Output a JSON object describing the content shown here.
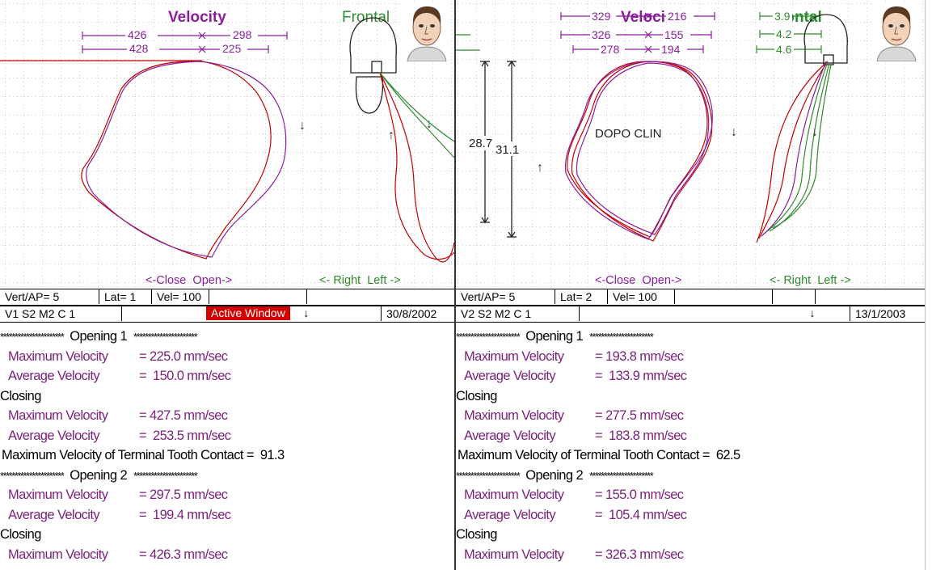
{
  "left_window": {
    "title_velocity": "Velocity",
    "title_frontal": "Frontal",
    "scale_top": [
      "426",
      "298"
    ],
    "scale_bottom": [
      "428",
      "225"
    ],
    "axis_sagittal": "<-Close  Open->",
    "axis_frontal": "<- Right  Left ->",
    "status": {
      "vert_ap": "Vert/AP= 5",
      "lat": "Lat= 1",
      "vel": "Vel= 100",
      "session": "V1 S2   M2  C 1",
      "active": "Active Window",
      "arrow": "↓",
      "date": "30/8/2002"
    },
    "report": {
      "stars": "**********************",
      "opening1": "Opening 1",
      "closing": "Closing",
      "max_label": "Maximum Velocity",
      "avg_label": "Average Velocity",
      "op1_max": "= 225.0 mm/sec",
      "op1_avg": "=  150.0 mm/sec",
      "cl1_max": "= 427.5 mm/sec",
      "cl1_avg": "=  253.5 mm/sec",
      "terminal": "Maximum Velocity of Terminal Tooth Contact =  91.3",
      "opening2": "Opening 2",
      "op2_max": "= 297.5 mm/sec",
      "op2_avg": "=  199.4 mm/sec",
      "cl2_max": "= 426.3 mm/sec"
    }
  },
  "right_window": {
    "title_velocity": "Veloci",
    "title_frontal": "rontal",
    "scale_row1": [
      "329",
      "216"
    ],
    "scale_row2": [
      "326",
      "155"
    ],
    "scale_row3": [
      "278",
      "194"
    ],
    "frontal_scale": [
      "3.9",
      "4.2",
      "4.6"
    ],
    "annotation": "DOPO CLIN",
    "dim_a": "28.7",
    "dim_b": "31.1",
    "axis_sagittal": "<-Close  Open->",
    "axis_frontal": "<- Right  Left ->",
    "status": {
      "vert_ap": "Vert/AP= 5",
      "lat": "Lat= 2",
      "vel": "Vel= 100",
      "session": "V2 S2   M2  C 1",
      "arrow": "↓",
      "date": "13/1/2003"
    },
    "report": {
      "stars": "**********************",
      "opening1": "Opening 1",
      "closing": "Closing",
      "max_label": "Maximum Velocity",
      "avg_label": "Average Velocity",
      "op1_max": "= 193.8 mm/sec",
      "op1_avg": "=  133.9 mm/sec",
      "cl1_max": "= 277.5 mm/sec",
      "cl1_avg": "=  183.8 mm/sec",
      "terminal": "Maximum Velocity of Terminal Tooth Contact =  62.5",
      "opening2": "Opening 2",
      "op2_max": "= 155.0 mm/sec",
      "op2_avg": "=  105.4 mm/sec",
      "cl2_max": "= 326.3 mm/sec"
    }
  },
  "colors": {
    "purple": "#8b1e9b",
    "green": "#2e8b2e",
    "red": "#c00000",
    "grid": "#9aa0a6",
    "report_label": "#7a1f7a"
  },
  "icons": [
    "face-icon",
    "arrow-down-icon",
    "arrow-up-icon",
    "tooth-outline-icon"
  ]
}
